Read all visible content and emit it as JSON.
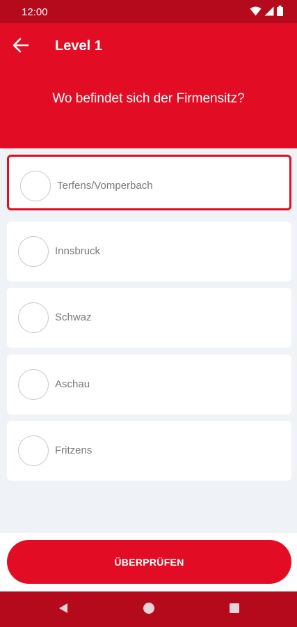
{
  "status_bar": {
    "time": "12:00",
    "icons": [
      "wifi-icon",
      "signal-icon",
      "battery-icon"
    ]
  },
  "header": {
    "back_icon": "arrow-left-icon",
    "title": "Level 1",
    "question": "Wo befindet sich der Firmensitz?"
  },
  "options": [
    {
      "label": "Terfens/Vomperbach",
      "selected": true
    },
    {
      "label": "Innsbruck",
      "selected": false
    },
    {
      "label": "Schwaz",
      "selected": false
    },
    {
      "label": "Aschau",
      "selected": false
    },
    {
      "label": "Fritzens",
      "selected": false
    }
  ],
  "actions": {
    "check_label": "ÜBERPRÜFEN"
  },
  "nav_bar": {
    "icons": [
      "back-triangle-icon",
      "home-circle-icon",
      "recents-square-icon"
    ]
  },
  "colors": {
    "primary": "#e20d24",
    "primary_dark": "#b50a1c",
    "background": "#eff2f6",
    "card": "#ffffff",
    "option_text": "#7a7a7a"
  }
}
